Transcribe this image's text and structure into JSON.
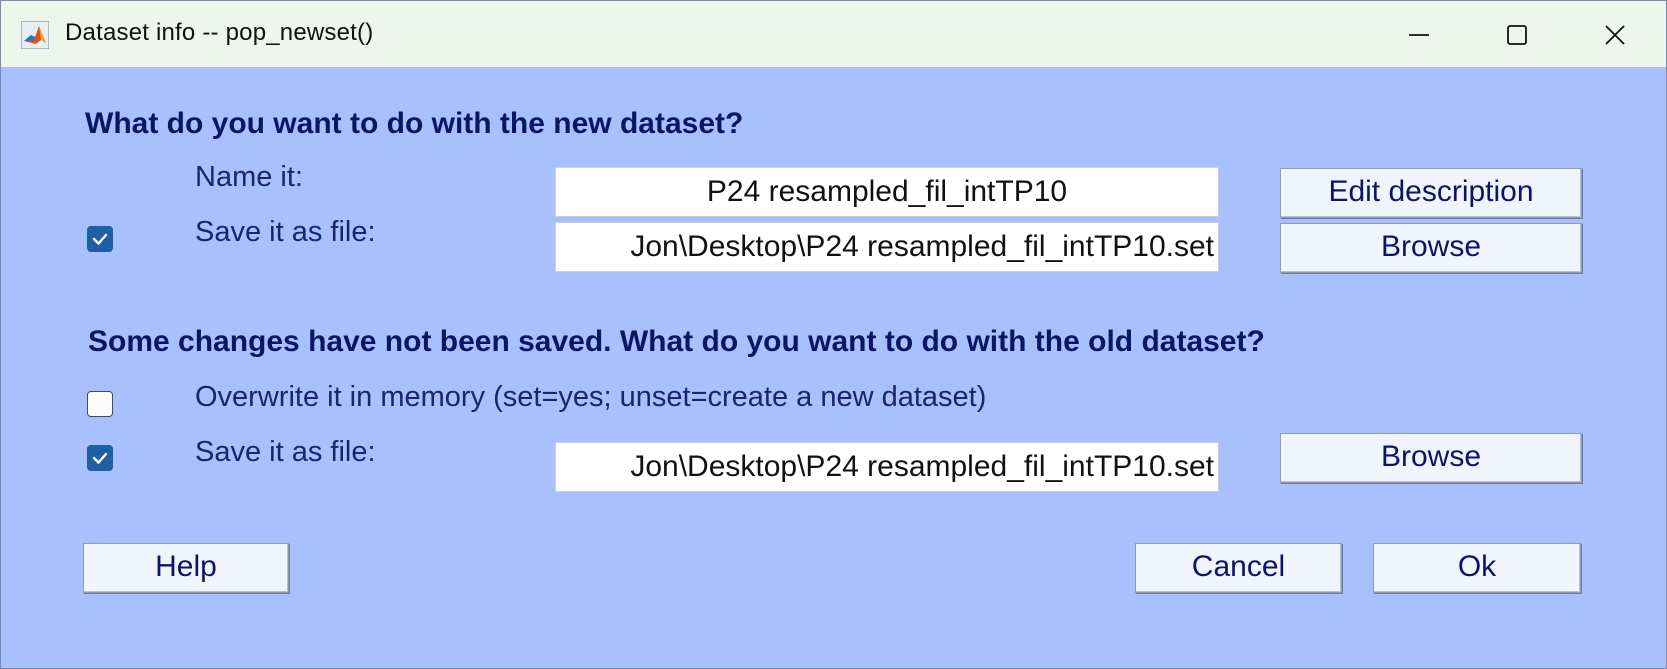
{
  "window": {
    "title": "Dataset info -- pop_newset()",
    "icon": "matlab-icon"
  },
  "new_dataset": {
    "heading": "What do you want to do with the new dataset?",
    "name_label": "Name it:",
    "name_value": "P24 resampled_fil_intTP10",
    "edit_description_label": "Edit description",
    "save_checked": true,
    "save_label": "Save it as file:",
    "save_path": "Jon\\Desktop\\P24 resampled_fil_intTP10.set",
    "browse_label": "Browse"
  },
  "old_dataset": {
    "heading": "Some changes have not been saved. What do you want to do with the old dataset?",
    "overwrite_checked": false,
    "overwrite_label": "Overwrite it in memory (set=yes; unset=create a new dataset)",
    "save_checked": true,
    "save_label": "Save it as file:",
    "save_path": "Jon\\Desktop\\P24 resampled_fil_intTP10.set",
    "browse_label": "Browse"
  },
  "footer": {
    "help_label": "Help",
    "cancel_label": "Cancel",
    "ok_label": "Ok"
  },
  "colors": {
    "dialog_bg": "#a8c0fe",
    "titlebar_bg": "#eef5ec",
    "heading_text": "#0c1466",
    "checkbox_checked": "#1f5fa6"
  }
}
